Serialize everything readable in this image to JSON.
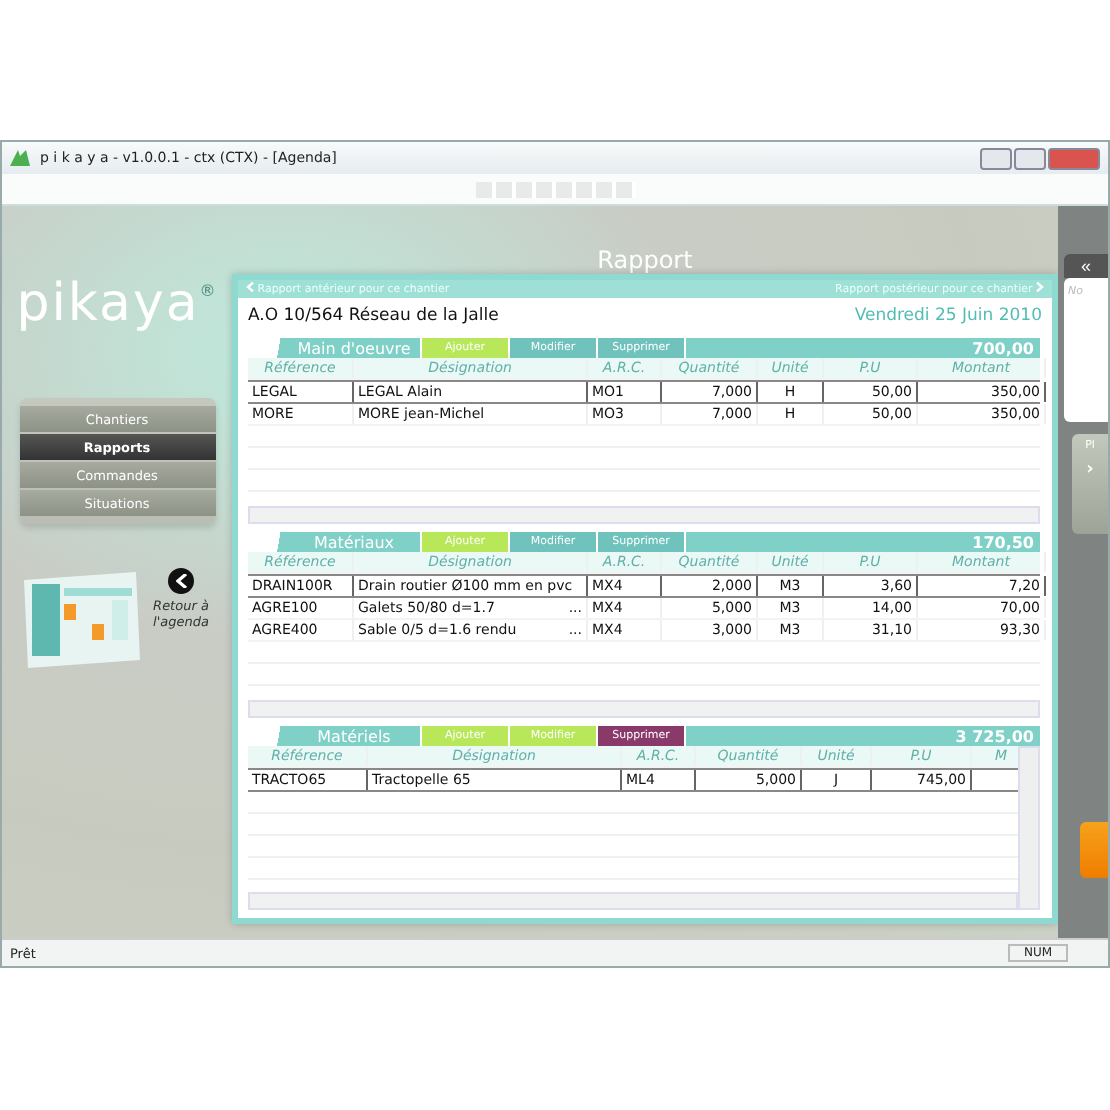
{
  "window": {
    "title": "p i k a y a - v1.0.0.1 - ctx (CTX) - [Agenda]"
  },
  "sidebar": {
    "logo": "pikaya",
    "logo_mark": "®",
    "items": [
      {
        "label": "Chantiers",
        "selected": false
      },
      {
        "label": "Rapports",
        "selected": true
      },
      {
        "label": "Commandes",
        "selected": false
      },
      {
        "label": "Situations",
        "selected": false
      }
    ],
    "back_link": "Retour à l'agenda"
  },
  "report": {
    "title": "Rapport",
    "previous": "Rapport antérieur pour ce chantier",
    "next": "Rapport postérieur pour ce chantier",
    "site": "A.O 10/564 Réseau de la Jalle",
    "date": "Vendredi 25 Juin 2010",
    "sections": [
      {
        "title": "Main d'oeuvre",
        "total": "700,00",
        "vertical_scroll": false,
        "buttons": [
          {
            "label": "Ajouter",
            "color": "#b8e85a"
          },
          {
            "label": "Modifier",
            "color": "#6fc3bc"
          },
          {
            "label": "Supprimer",
            "color": "#6fc3bc"
          }
        ],
        "columns": [
          "Référence",
          "Désignation",
          "A.R.C.",
          "Quantité",
          "Unité",
          "P.U",
          "Montant"
        ],
        "rows": [
          {
            "selected": true,
            "cells": [
              "LEGAL",
              "LEGAL Alain",
              "MO1",
              "7,000",
              "H",
              "50,00",
              "350,00"
            ]
          },
          {
            "selected": false,
            "cells": [
              "MORE",
              "MORE jean-Michel",
              "MO3",
              "7,000",
              "H",
              "50,00",
              "350,00"
            ]
          }
        ]
      },
      {
        "title": "Matériaux",
        "total": "170,50",
        "vertical_scroll": false,
        "buttons": [
          {
            "label": "Ajouter",
            "color": "#b8e85a"
          },
          {
            "label": "Modifier",
            "color": "#6fc3bc"
          },
          {
            "label": "Supprimer",
            "color": "#6fc3bc"
          }
        ],
        "columns": [
          "Référence",
          "Désignation",
          "A.R.C.",
          "Quantité",
          "Unité",
          "P.U",
          "Montant"
        ],
        "rows": [
          {
            "selected": true,
            "cells": [
              "DRAIN100R",
              "Drain routier Ø100 mm en pvc",
              "MX4",
              "2,000",
              "M3",
              "3,60",
              "7,20"
            ]
          },
          {
            "selected": false,
            "overflow_mark": "...",
            "cells": [
              "AGRE100",
              "Galets 50/80 d=1.7",
              "MX4",
              "5,000",
              "M3",
              "14,00",
              "70,00"
            ]
          },
          {
            "selected": false,
            "overflow_mark": "...",
            "cells": [
              "AGRE400",
              "Sable 0/5 d=1.6 rendu",
              "MX4",
              "3,000",
              "M3",
              "31,10",
              "93,30"
            ]
          }
        ]
      },
      {
        "title": "Matériels",
        "total": "3 725,00",
        "vertical_scroll": true,
        "buttons": [
          {
            "label": "Ajouter",
            "color": "#b8e85a"
          },
          {
            "label": "Modifier",
            "color": "#b8e85a"
          },
          {
            "label": "Supprimer",
            "color": "#8a3a6a"
          }
        ],
        "columns": [
          "Référence",
          "Désignation",
          "A.R.C.",
          "Quantité",
          "Unité",
          "P.U",
          "M"
        ],
        "rows": [
          {
            "selected": true,
            "cells": [
              "TRACTO65",
              "Tractopelle 65",
              "ML4",
              "5,000",
              "J",
              "745,00",
              ""
            ]
          }
        ]
      }
    ]
  },
  "right_panel": {
    "collapse": "«",
    "note": "No",
    "tab": "Pl",
    "tab_arrow": "›"
  },
  "status_bar": {
    "text": "Prêt",
    "indicator": "NUM"
  }
}
